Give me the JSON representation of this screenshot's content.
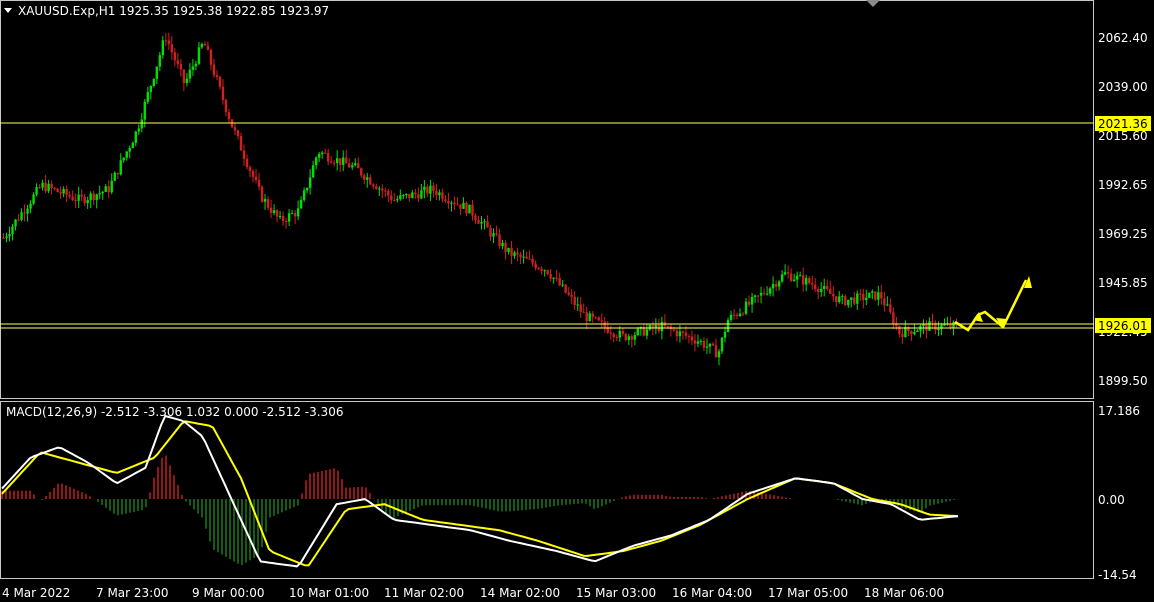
{
  "header": {
    "symbol_line": "XAUUSD.Exp,H1  1925.35 1925.38 1922.85 1923.97"
  },
  "price_axis": {
    "ticks": [
      "2062.40",
      "2039.00",
      "2015.60",
      "1992.65",
      "1969.25",
      "1945.85",
      "1922.45",
      "1899.50"
    ]
  },
  "levels": {
    "resistance": "2021.36",
    "support": "1926.01"
  },
  "macd": {
    "label": "MACD(12,26,9) -2.512 -3.306 1.032 0.000 -2.512 -3.306",
    "ticks": [
      "17.186",
      "0.00",
      "-14.54"
    ]
  },
  "time_axis": {
    "labels": [
      "4 Mar 2022",
      "7 Mar 23:00",
      "9 Mar 00:00",
      "10 Mar 01:00",
      "11 Mar 02:00",
      "14 Mar 02:00",
      "15 Mar 03:00",
      "16 Mar 04:00",
      "17 Mar 05:00",
      "18 Mar 06:00"
    ]
  },
  "colors": {
    "background": "#000000",
    "bull": "#00e000",
    "bear": "#d02020",
    "level_line": "#ffff66",
    "level_tag_bg": "#ffff00",
    "macd_line": "#ffffff",
    "signal_line": "#ffff00",
    "hist_up": "#c02020",
    "hist_down": "#1a7a1a",
    "forecast_arrow": "#ffff00",
    "axis_text": "#ffffff",
    "frame": "#c8c8c8"
  },
  "chart_data": {
    "type": "candlestick",
    "price_path": [
      [
        0,
        1967
      ],
      [
        0.04,
        1992
      ],
      [
        0.08,
        1985
      ],
      [
        0.11,
        1990
      ],
      [
        0.14,
        2018
      ],
      [
        0.17,
        2063
      ],
      [
        0.19,
        2040
      ],
      [
        0.21,
        2060
      ],
      [
        0.24,
        2020
      ],
      [
        0.27,
        1987
      ],
      [
        0.29,
        1975
      ],
      [
        0.31,
        1980
      ],
      [
        0.33,
        2008
      ],
      [
        0.37,
        2000
      ],
      [
        0.41,
        1985
      ],
      [
        0.45,
        1990
      ],
      [
        0.49,
        1980
      ],
      [
        0.53,
        1960
      ],
      [
        0.57,
        1952
      ],
      [
        0.61,
        1930
      ],
      [
        0.65,
        1920
      ],
      [
        0.69,
        1925
      ],
      [
        0.73,
        1918
      ],
      [
        0.75,
        1912
      ],
      [
        0.76,
        1928
      ],
      [
        0.79,
        1938
      ],
      [
        0.82,
        1950
      ],
      [
        0.85,
        1945
      ],
      [
        0.88,
        1937
      ],
      [
        0.92,
        1940
      ],
      [
        0.94,
        1922
      ],
      [
        0.97,
        1925
      ],
      [
        1,
        1925
      ]
    ],
    "macd_path": [
      [
        0,
        2
      ],
      [
        0.03,
        8
      ],
      [
        0.06,
        10
      ],
      [
        0.09,
        7
      ],
      [
        0.12,
        3
      ],
      [
        0.15,
        6
      ],
      [
        0.17,
        16
      ],
      [
        0.19,
        15
      ],
      [
        0.21,
        12
      ],
      [
        0.24,
        0
      ],
      [
        0.27,
        -12
      ],
      [
        0.31,
        -13
      ],
      [
        0.35,
        -1
      ],
      [
        0.38,
        0
      ],
      [
        0.41,
        -4
      ],
      [
        0.45,
        -5
      ],
      [
        0.49,
        -6
      ],
      [
        0.53,
        -8
      ],
      [
        0.58,
        -10
      ],
      [
        0.62,
        -12
      ],
      [
        0.66,
        -9
      ],
      [
        0.7,
        -7
      ],
      [
        0.74,
        -4
      ],
      [
        0.78,
        1
      ],
      [
        0.83,
        4
      ],
      [
        0.87,
        3
      ],
      [
        0.9,
        0
      ],
      [
        0.93,
        -1
      ],
      [
        0.96,
        -4
      ],
      [
        1,
        -3.3
      ]
    ],
    "signal_path": [
      [
        0,
        1
      ],
      [
        0.04,
        9
      ],
      [
        0.08,
        7
      ],
      [
        0.12,
        5
      ],
      [
        0.16,
        8
      ],
      [
        0.19,
        15
      ],
      [
        0.22,
        14
      ],
      [
        0.25,
        4
      ],
      [
        0.28,
        -10
      ],
      [
        0.32,
        -13
      ],
      [
        0.36,
        -2
      ],
      [
        0.4,
        -1
      ],
      [
        0.44,
        -4
      ],
      [
        0.48,
        -5
      ],
      [
        0.52,
        -6
      ],
      [
        0.56,
        -8
      ],
      [
        0.61,
        -11
      ],
      [
        0.65,
        -10
      ],
      [
        0.69,
        -8
      ],
      [
        0.73,
        -5
      ],
      [
        0.78,
        0
      ],
      [
        0.83,
        4
      ],
      [
        0.87,
        3
      ],
      [
        0.91,
        0
      ],
      [
        0.94,
        -1
      ],
      [
        0.97,
        -3
      ],
      [
        1,
        -3.3
      ]
    ]
  }
}
